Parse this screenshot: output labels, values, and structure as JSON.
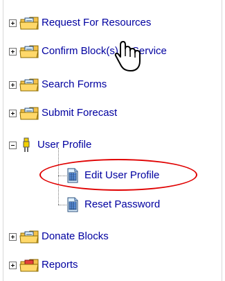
{
  "tree": {
    "items": [
      {
        "label": "Request For Resources"
      },
      {
        "label": "Confirm Block(s) in Service"
      },
      {
        "label": "Search Forms"
      },
      {
        "label": "Submit Forecast"
      },
      {
        "label": "User Profile"
      },
      {
        "label": "Edit User Profile"
      },
      {
        "label": "Reset Password"
      },
      {
        "label": "Donate Blocks"
      },
      {
        "label": "Reports"
      }
    ]
  },
  "icons": {
    "folder": "folder-icon",
    "document": "document-icon",
    "person": "user-icon",
    "reports": "reports-folder-icon",
    "expand": "plus-toggle-icon",
    "collapse": "minus-toggle-icon",
    "cursor": "hand-cursor-icon"
  },
  "colors": {
    "link": "#0000a0",
    "highlight": "#e00000",
    "folder": "#f4c24c",
    "document": "#6aa5ff",
    "reports": "#e5403a"
  }
}
